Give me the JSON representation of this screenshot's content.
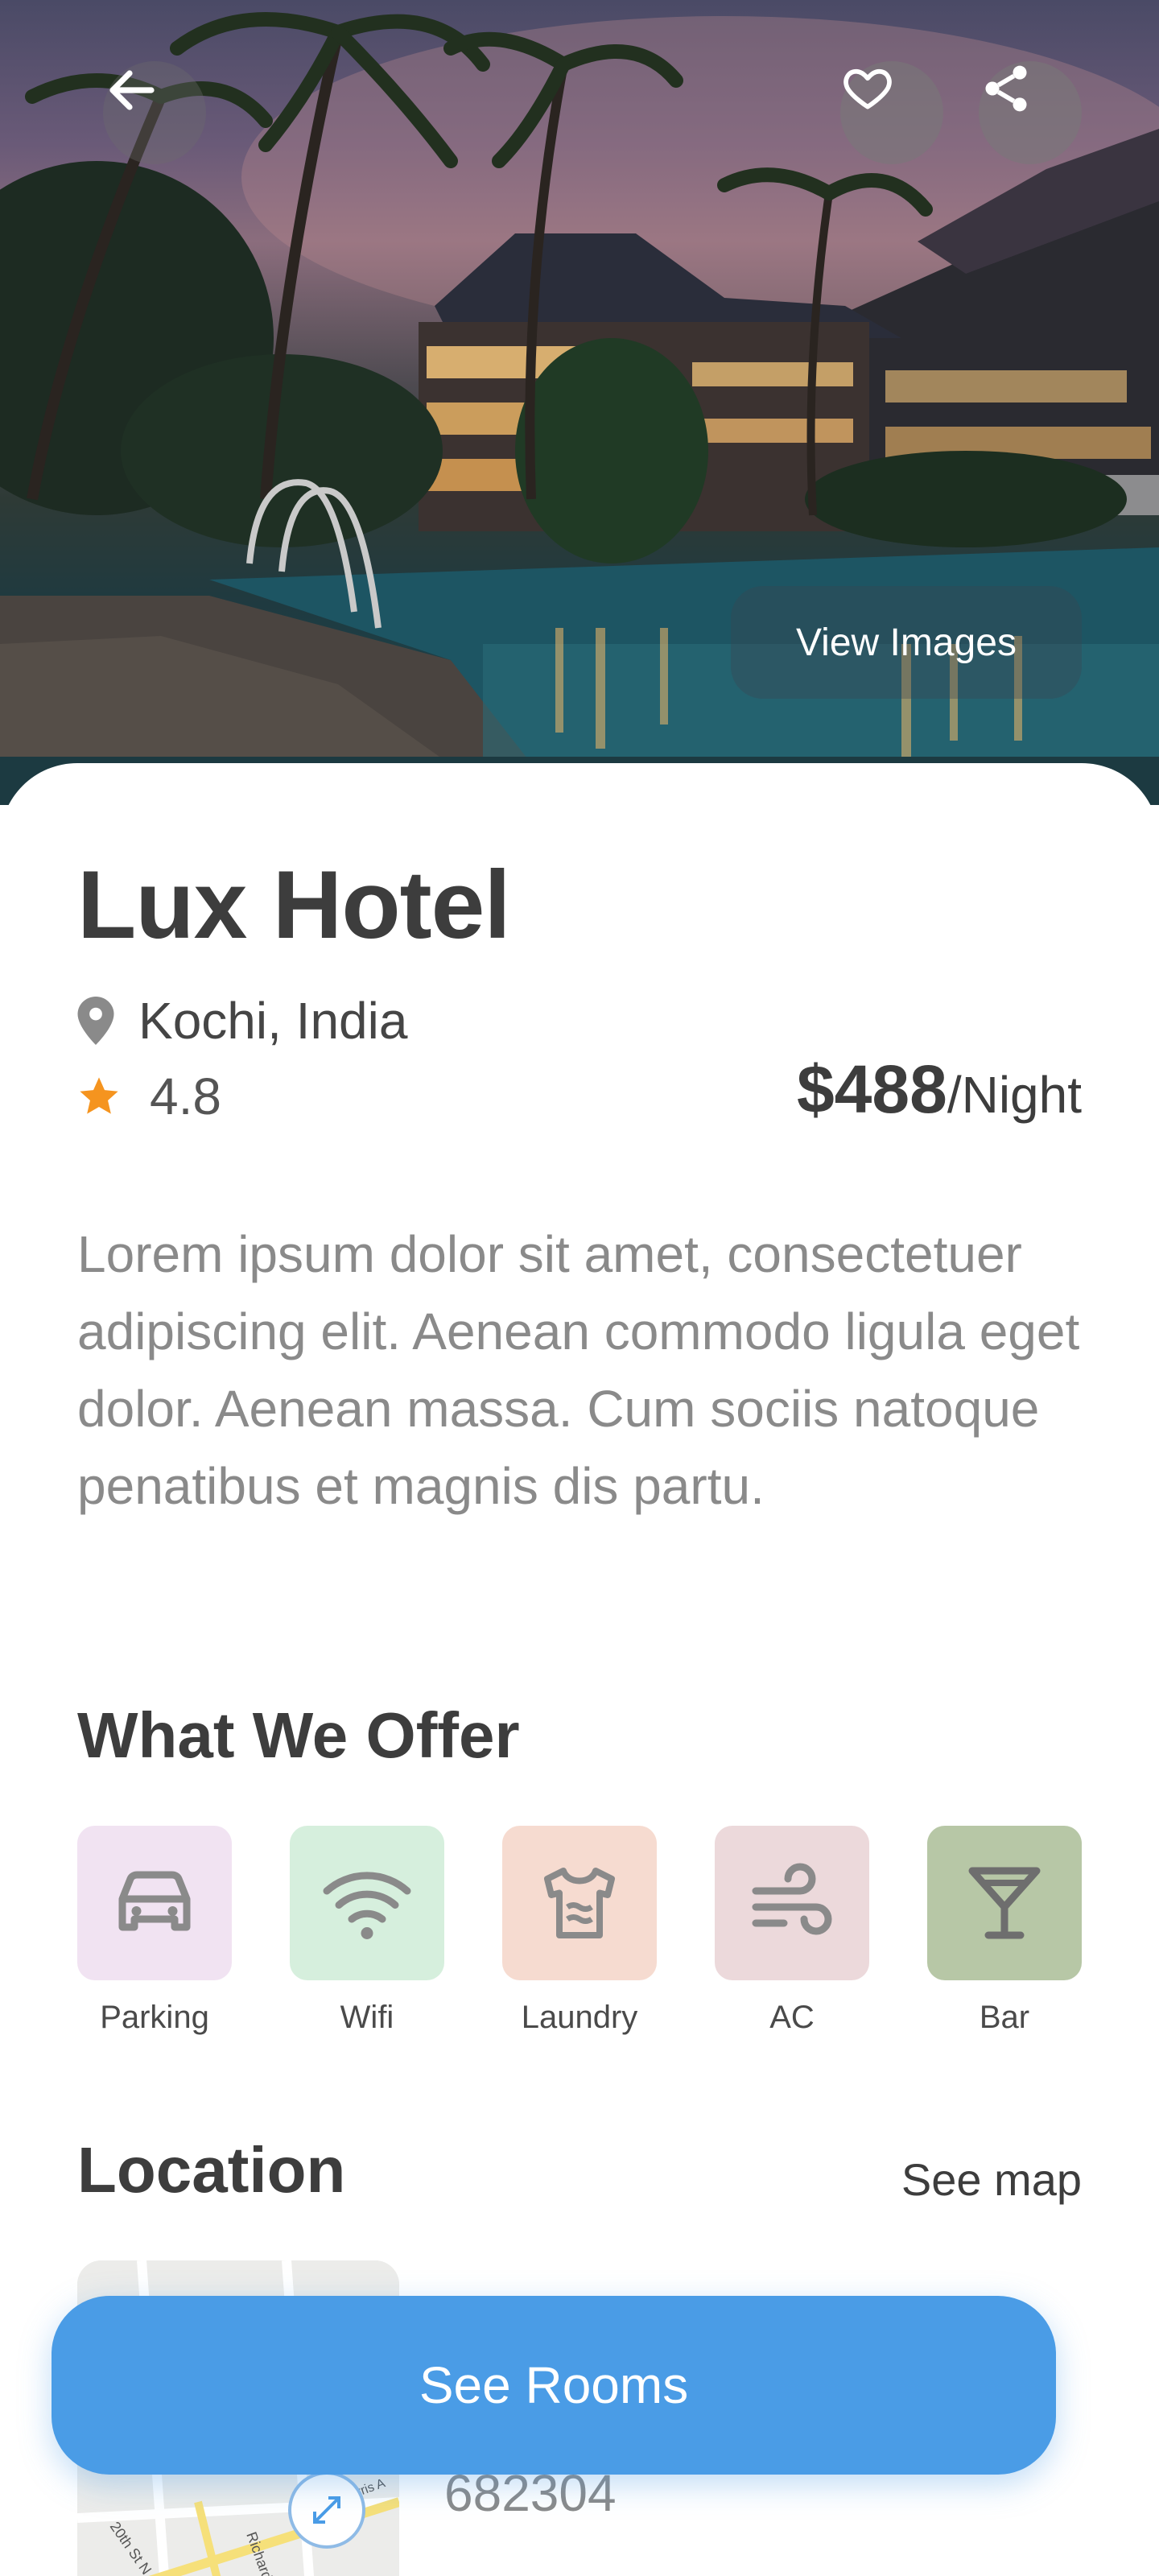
{
  "hero": {
    "view_images_label": "View Images"
  },
  "hotel": {
    "name": "Lux Hotel",
    "location": "Kochi, India",
    "rating": "4.8",
    "price_amount": "$488",
    "price_unit": "/Night",
    "description": "Lorem ipsum dolor sit amet, consectetuer adipiscing elit. Aenean commodo ligula eget dolor. Aenean massa. Cum sociis natoque penatibus et magnis dis partu."
  },
  "offers": {
    "title": "What We Offer",
    "items": [
      {
        "label": "Parking",
        "icon": "car-icon",
        "color": "#f1e3f2"
      },
      {
        "label": "Wifi",
        "icon": "wifi-icon",
        "color": "#d6efdd"
      },
      {
        "label": "Laundry",
        "icon": "laundry-icon",
        "color": "#f6dbd0"
      },
      {
        "label": "AC",
        "icon": "wind-icon",
        "color": "#ecd9db"
      },
      {
        "label": "Bar",
        "icon": "cocktail-icon",
        "color": "#b7c7a6"
      }
    ]
  },
  "location": {
    "title": "Location",
    "see_map_label": "See map",
    "address_line": "682304",
    "map_labels": [
      "20th St N",
      "Richards",
      "Harris A"
    ]
  },
  "cta": {
    "label": "See Rooms",
    "color": "#4a9ce6"
  },
  "colors": {
    "star": "#f5941f",
    "pin": "#8a8a8a"
  }
}
